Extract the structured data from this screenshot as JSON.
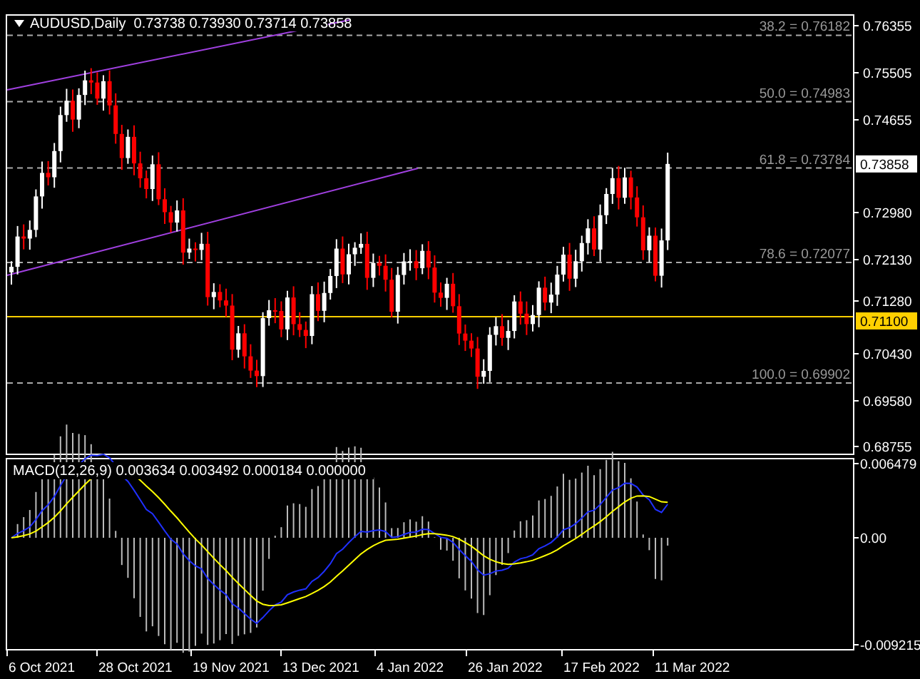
{
  "symbol_bar": {
    "symbol": "AUDUSD,Daily",
    "ohlc": [
      "0.73738",
      "0.73930",
      "0.73714",
      "0.73858"
    ]
  },
  "fib_levels": [
    {
      "label": "38.2 = 0.76182"
    },
    {
      "label": "50.0 = 0.74983"
    },
    {
      "label": "61.8 = 0.73784"
    },
    {
      "label": "78.6 = 0.72077"
    },
    {
      "label": "100.0 = 0.69902"
    }
  ],
  "price_axis": [
    "0.76355",
    "0.75505",
    "0.74655",
    "0.72980",
    "0.72130",
    "0.71280",
    "0.70430",
    "0.69580",
    "0.68755"
  ],
  "current_price": "0.73858",
  "horizontal_line_price": "0.71100",
  "macd": {
    "title": "MACD(12,26,9) 0.003634 0.003492 0.000184 0.000000",
    "axis": [
      "0.006479",
      "0.00",
      "-0.009215"
    ]
  },
  "time_axis": [
    "6 Oct 2021",
    "28 Oct 2021",
    "19 Nov 2021",
    "13 Dec 2021",
    "4 Jan 2022",
    "26 Jan 2022",
    "17 Feb 2022",
    "11 Mar 2022"
  ]
}
